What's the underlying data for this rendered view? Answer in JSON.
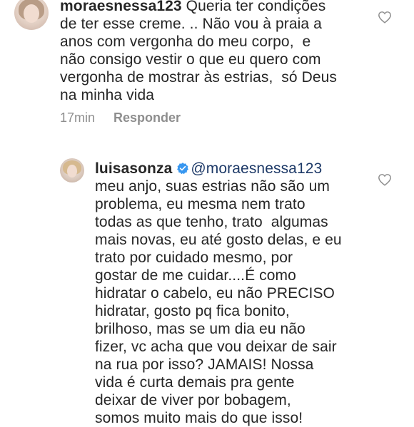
{
  "comment1": {
    "username": "moraesnessa123",
    "lines": [
      " Queria ter condições",
      "de ter esse creme. .. Não vou à praia a",
      "anos com vergonha do meu corpo,  e",
      "não consigo vestir o que eu quero com",
      "vergonha de mostrar às estrias,  só Deus",
      "na minha vida"
    ],
    "time": "17min",
    "reply_label": "Responder",
    "like_icon": "heart-outline-icon"
  },
  "comment2": {
    "username": "luisasonza",
    "verified_icon": "verified-badge-icon",
    "mention": "@moraesnessa123",
    "lines": [
      "meu anjo, suas estrias não são um",
      "problema, eu mesma nem trato",
      "todas as que tenho, trato  algumas",
      "mais novas, eu até gosto delas, e eu",
      "trato por cuidado mesmo, por",
      "gostar de me cuidar....É como",
      "hidratar o cabelo, eu não PRECISO",
      "hidratar, gosto pq fica bonito,",
      "brilhoso, mas se um dia eu não",
      "fizer, vc acha que vou deixar de sair",
      "na rua por isso? JAMAIS! Nossa",
      "vida é curta demais pra gente",
      "deixar de viver por bobagem,",
      "somos muito mais do que isso!"
    ],
    "like_icon": "heart-outline-icon"
  },
  "colors": {
    "text": "#262626",
    "muted": "#8e8e8e",
    "mention": "#1e3a68",
    "verified": "#3897f0"
  }
}
